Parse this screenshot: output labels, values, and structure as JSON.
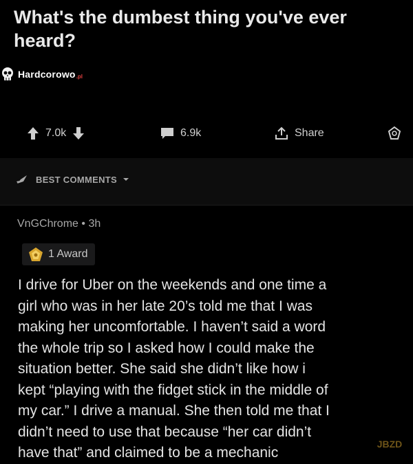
{
  "post": {
    "title": "What's the dumbest thing you've ever heard?"
  },
  "watermark": {
    "text": "Hardcorowo",
    "suffix": ".pl"
  },
  "actions": {
    "upvotes": "7.0k",
    "comments": "6.9k",
    "share_label": "Share",
    "up_color": "#cfcfcf",
    "award_icon": "award-icon"
  },
  "sort": {
    "label": "BEST COMMENTS"
  },
  "comment": {
    "author": "VnGChrome",
    "separator": "•",
    "age": "3h",
    "award_label": "1 Award",
    "lines": [
      "I drive for Uber on the weekends and one time a",
      "girl who was in her late 20’s told me that I was",
      "making her uncomfortable. I haven’t said a word",
      "the whole trip so I asked how I could make the",
      "situation better. She said she didn’t like how i",
      "kept “playing with the fidget stick in the middle of",
      "my car.” I drive a manual. She then told me that I",
      "didn’t need to use that because “her car didn’t",
      "have that” and claimed to be a mechanic"
    ]
  },
  "corner_logo": {
    "text": "JBZD"
  }
}
